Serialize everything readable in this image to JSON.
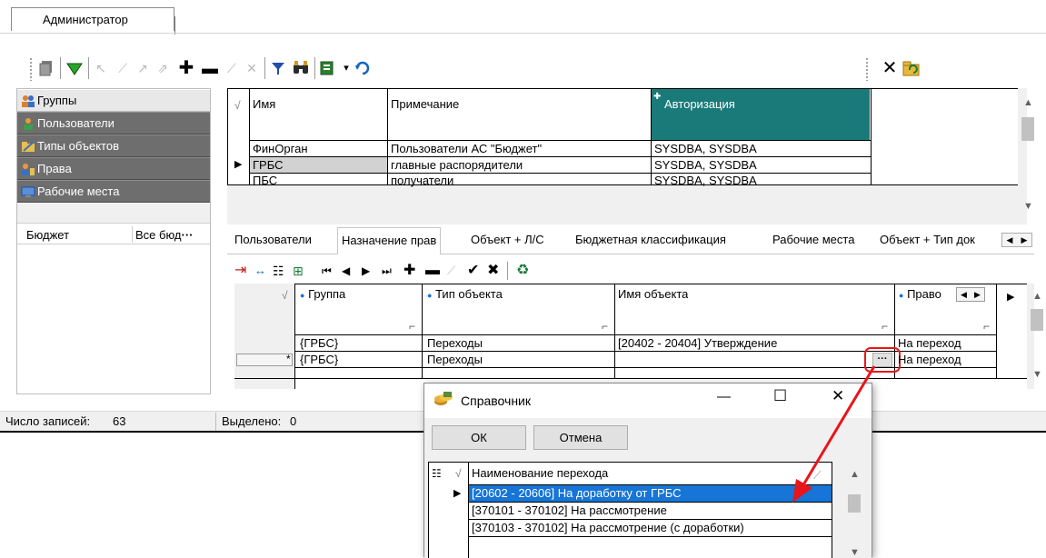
{
  "top_tab": {
    "label": "Администратор"
  },
  "toolbar": {
    "buttons": [
      "copy-icon",
      "filter-icon",
      "undo-icon",
      "first-icon",
      "prev-icon",
      "next-icon",
      "add-icon",
      "remove-icon",
      "edit-icon",
      "cancel-icon",
      "funnel-icon",
      "binoculars-icon",
      "export-icon",
      "refresh-icon"
    ],
    "dropdown_glyph": "▾",
    "close_glyph": "✕"
  },
  "sidebar": {
    "items": [
      {
        "label": "Группы",
        "icon": "group-icon"
      },
      {
        "label": "Пользователи",
        "icon": "user-icon"
      },
      {
        "label": "Типы объектов",
        "icon": "folder-icon"
      },
      {
        "label": "Права",
        "icon": "rights-icon"
      },
      {
        "label": "Рабочие места",
        "icon": "workplace-icon"
      }
    ],
    "filter": {
      "label": "Бюджет",
      "value": "Все бюд",
      "ellipsis": "···"
    }
  },
  "groups_table": {
    "columns": [
      "Имя",
      "Примечание",
      "Авторизация"
    ],
    "rows": [
      {
        "name": "ФинОрган",
        "note": "Пользователи АС \"Бюджет\"",
        "auth": "SYSDBA, SYSDBA"
      },
      {
        "name": "ГРБС",
        "note": "главные распорядители",
        "auth": "SYSDBA, SYSDBA"
      },
      {
        "name": "ПБС",
        "note": "получатели",
        "auth": "SYSDBA, SYSDBA"
      }
    ],
    "current_row_marker": "▶",
    "accent": "#1a7a7a"
  },
  "tabs": [
    {
      "label": "Пользователи"
    },
    {
      "label": "Назначение прав"
    },
    {
      "label": "Объект + Л/С"
    },
    {
      "label": "Бюджетная классификация"
    },
    {
      "label": "Рабочие места"
    },
    {
      "label": "Объект + Тип док"
    }
  ],
  "rights_table": {
    "columns": [
      "Группа",
      "Тип объекта",
      "Имя объекта",
      "Право"
    ],
    "rows": [
      {
        "group": "{ГРБС}",
        "type": "Переходы",
        "object": "[20402 - 20404] Утверждение",
        "right": "На переход"
      },
      {
        "group": "{ГРБС}",
        "type": "Переходы",
        "object": "",
        "right": "На переход"
      }
    ],
    "new_row_marker": "*",
    "ellipsis": "···"
  },
  "status": {
    "records_label": "Число записей:",
    "records_value": "63",
    "selected_label": "Выделено:",
    "selected_value": "0"
  },
  "dialog": {
    "title": "Справочник",
    "ok_label": "ОК",
    "cancel_label": "Отмена",
    "column": "Наименование перехода",
    "rows": [
      "[20602 - 20606] На доработку от ГРБС",
      "[370101 - 370102] На рассмотрение",
      "[370103 - 370102] На рассмотрение (с доработки)"
    ],
    "minimize_glyph": "—",
    "maximize_glyph": "☐",
    "close_glyph": "✕"
  },
  "colors": {
    "annotation": "#e8151b",
    "selection": "#1675d6",
    "header_accent": "#1a7a7a"
  }
}
